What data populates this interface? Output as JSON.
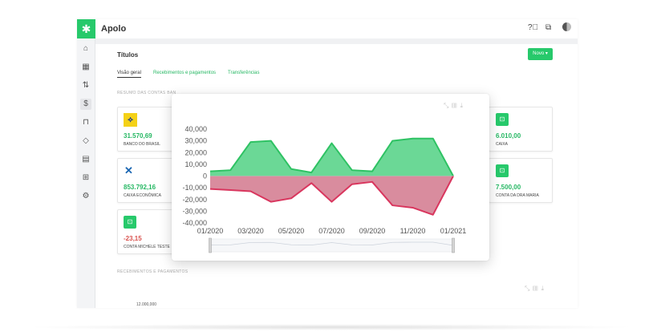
{
  "app": {
    "name": "Apolo",
    "logo_icon": "gear-flower-icon",
    "accent": "#27c96b"
  },
  "topbar": {
    "icons": [
      "help-icon",
      "switch-icon"
    ]
  },
  "sidebar": {
    "icons": [
      "home-icon",
      "calendar-icon",
      "transfer-icon",
      "money-icon",
      "bag-icon",
      "tag-icon",
      "report-icon",
      "grid-icon",
      "settings-icon"
    ]
  },
  "page": {
    "title": "Títulos",
    "new_button": "Novo ▾",
    "tabs": [
      {
        "label": "Visão geral",
        "active": true
      },
      {
        "label": "Recebimentos e pagamentos",
        "active": false
      },
      {
        "label": "Transferências",
        "active": false
      }
    ],
    "section_accounts": "RESUMO DAS CONTAS BAN",
    "section_receipts": "RECEBIMENTOS E PAGAMENTOS",
    "big_chart_ylabel": "12.000,000"
  },
  "accounts": [
    {
      "value": "31.570,69",
      "name": "BANCO DO BRASIL",
      "color": "#27b864",
      "icon": "banco-do-brasil-logo"
    },
    {
      "value": "853.792,16",
      "name": "CAIXA ECONÔMICA",
      "color": "#27b864",
      "icon": "caixa-logo"
    },
    {
      "value": "-23,15",
      "name": "CONTA MICHELE TESTE",
      "color": "#d9534f",
      "icon": "safe-icon"
    },
    {
      "value": "6.010,00",
      "name": "CAIXA",
      "color": "#27b864",
      "icon": "safe-icon"
    },
    {
      "value": "7.500,00",
      "name": "CONTA DA DRA MARIA",
      "color": "#27b864",
      "icon": "safe-icon"
    }
  ],
  "chart_data": {
    "type": "area",
    "x": [
      "01/2020",
      "02/2020",
      "03/2020",
      "04/2020",
      "05/2020",
      "06/2020",
      "07/2020",
      "08/2020",
      "09/2020",
      "10/2020",
      "11/2020",
      "12/2020",
      "01/2021"
    ],
    "x_tick_labels": [
      "01/2020",
      "03/2020",
      "05/2020",
      "07/2020",
      "09/2020",
      "11/2020",
      "01/2021"
    ],
    "y_tick_labels": [
      "40,000",
      "30,000",
      "20,000",
      "10,000",
      "0",
      "-10,000",
      "-20,000",
      "-30,000",
      "-40,000"
    ],
    "ylim": [
      -40000,
      40000
    ],
    "series": [
      {
        "values": [
          4000,
          5000,
          29000,
          30000,
          6000,
          3000,
          28000,
          5000,
          4000,
          30000,
          32000,
          32000,
          0
        ],
        "color": "#6bd896",
        "stroke": "#2ec263"
      },
      {
        "values": [
          -11000,
          -12000,
          -13000,
          -22000,
          -19000,
          -6000,
          -22000,
          -7000,
          -5000,
          -25000,
          -27000,
          -33000,
          0
        ],
        "color": "#d98c9e",
        "stroke": "#d9365e"
      }
    ],
    "legend": "none",
    "toolbar_icons": [
      "zoom-icon",
      "bar-mode-icon",
      "download-icon"
    ]
  }
}
